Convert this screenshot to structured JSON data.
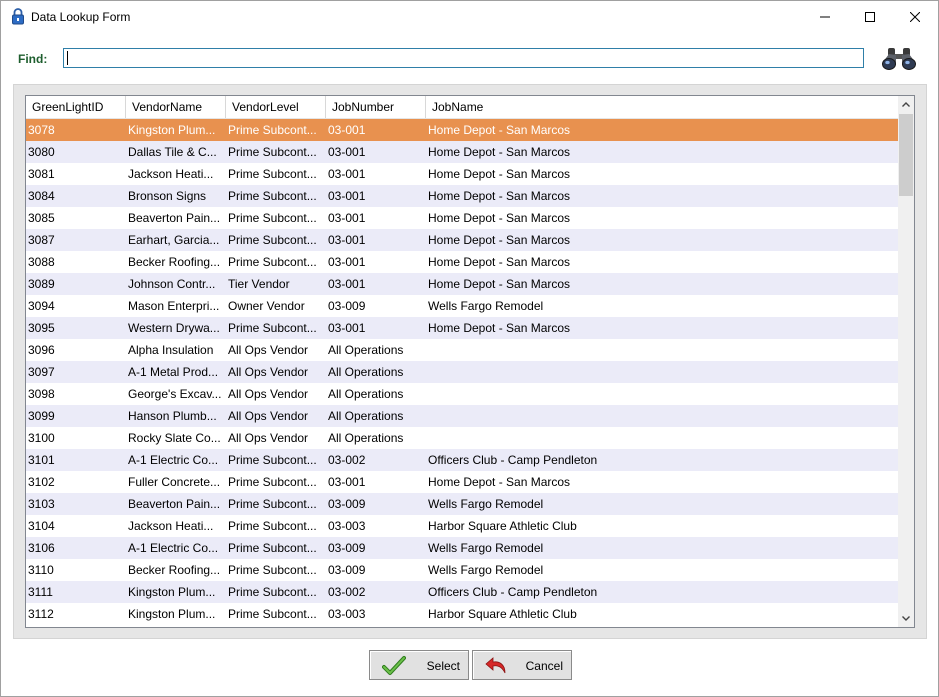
{
  "window": {
    "title": "Data Lookup Form"
  },
  "find": {
    "label": "Find:",
    "value": ""
  },
  "grid": {
    "columns": [
      "GreenLightID",
      "VendorName",
      "VendorLevel",
      "JobNumber",
      "JobName"
    ],
    "selected_row": 0,
    "rows": [
      [
        "3078",
        "Kingston Plum...",
        "Prime Subcont...",
        "03-001",
        "Home Depot - San Marcos"
      ],
      [
        "3080",
        "Dallas Tile & C...",
        "Prime Subcont...",
        "03-001",
        "Home Depot - San Marcos"
      ],
      [
        "3081",
        "Jackson Heati...",
        "Prime Subcont...",
        "03-001",
        "Home Depot - San Marcos"
      ],
      [
        "3084",
        "Bronson Signs",
        "Prime Subcont...",
        "03-001",
        "Home Depot - San Marcos"
      ],
      [
        "3085",
        "Beaverton Pain...",
        "Prime Subcont...",
        "03-001",
        "Home Depot - San Marcos"
      ],
      [
        "3087",
        "Earhart, Garcia...",
        "Prime Subcont...",
        "03-001",
        "Home Depot - San Marcos"
      ],
      [
        "3088",
        "Becker Roofing...",
        "Prime Subcont...",
        "03-001",
        "Home Depot - San Marcos"
      ],
      [
        "3089",
        "Johnson Contr...",
        "Tier Vendor",
        "03-001",
        "Home Depot - San Marcos"
      ],
      [
        "3094",
        "Mason Enterpri...",
        "Owner Vendor",
        "03-009",
        "Wells Fargo Remodel"
      ],
      [
        "3095",
        "Western Drywa...",
        "Prime Subcont...",
        "03-001",
        "Home Depot - San Marcos"
      ],
      [
        "3096",
        "Alpha Insulation",
        "All Ops Vendor",
        "All Operations",
        ""
      ],
      [
        "3097",
        "A-1 Metal Prod...",
        "All Ops Vendor",
        "All Operations",
        ""
      ],
      [
        "3098",
        "George's Excav...",
        "All Ops Vendor",
        "All Operations",
        ""
      ],
      [
        "3099",
        "Hanson Plumb...",
        "All Ops Vendor",
        "All Operations",
        ""
      ],
      [
        "3100",
        "Rocky Slate Co...",
        "All Ops Vendor",
        "All Operations",
        ""
      ],
      [
        "3101",
        "A-1 Electric Co...",
        "Prime Subcont...",
        "03-002",
        "Officers Club - Camp Pendleton"
      ],
      [
        "3102",
        "Fuller Concrete...",
        "Prime Subcont...",
        "03-001",
        "Home Depot - San Marcos"
      ],
      [
        "3103",
        "Beaverton Pain...",
        "Prime Subcont...",
        "03-009",
        "Wells Fargo Remodel"
      ],
      [
        "3104",
        "Jackson Heati...",
        "Prime Subcont...",
        "03-003",
        "Harbor Square Athletic Club"
      ],
      [
        "3106",
        "A-1 Electric Co...",
        "Prime Subcont...",
        "03-009",
        "Wells Fargo Remodel"
      ],
      [
        "3110",
        "Becker Roofing...",
        "Prime Subcont...",
        "03-009",
        "Wells Fargo Remodel"
      ],
      [
        "3111",
        "Kingston Plum...",
        "Prime Subcont...",
        "03-002",
        "Officers Club - Camp Pendleton"
      ],
      [
        "3112",
        "Kingston Plum...",
        "Prime Subcont...",
        "03-003",
        "Harbor Square Athletic Club"
      ]
    ]
  },
  "buttons": {
    "select_label": "Select",
    "cancel_label": "Cancel"
  },
  "icons": {
    "app": "padlock-icon",
    "minimize": "minimize-icon",
    "maximize": "maximize-icon",
    "close": "close-icon",
    "search": "binoculars-icon",
    "select": "checkmark-icon",
    "cancel": "undo-arrow-icon"
  },
  "colors": {
    "selected_row": "#e8914f",
    "alt_row": "#ebebf8",
    "find_label": "#1e5e2e",
    "input_border": "#2f7fa8"
  }
}
